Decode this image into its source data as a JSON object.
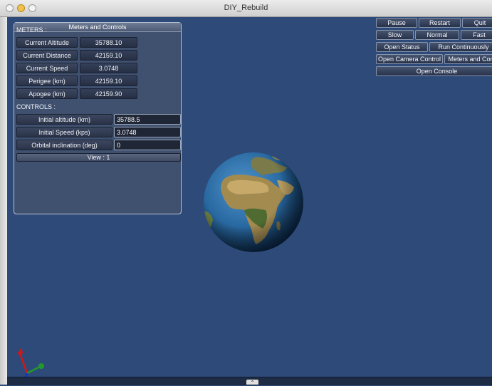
{
  "window": {
    "title": "DIY_Rebuild"
  },
  "panel": {
    "title": "Meters and Controls",
    "meters_label": "METERS :",
    "meters": [
      {
        "label": "Current Altitude",
        "value": "35788.10"
      },
      {
        "label": "Current Distance",
        "value": "42159.10"
      },
      {
        "label": "Current Speed",
        "value": "3.0748"
      },
      {
        "label": "Perigee (km)",
        "value": "42159.10"
      },
      {
        "label": "Apogee (km)",
        "value": "42159.90"
      }
    ],
    "controls_label": "CONTROLS :",
    "controls": [
      {
        "label": "Initial altitude (km)",
        "value": "35788.5"
      },
      {
        "label": "Initial Speed (kps)",
        "value": "3.0748"
      },
      {
        "label": "Orbital inclination (deg)",
        "value": "0"
      }
    ],
    "view_label": "View : 1"
  },
  "toolbar": {
    "pause": "Pause",
    "restart": "Restart",
    "quit": "Quit",
    "slow": "Slow",
    "normal": "Normal",
    "fast": "Fast",
    "open_status": "Open Status",
    "run_continuously": "Run Continuously",
    "open_camera_control": "Open Camera Control",
    "meters_and_controls": "Meters and Con",
    "open_console": "Open Console"
  },
  "bottom": {
    "knob": "⌃"
  },
  "colors": {
    "background": "#2e4a79",
    "panel_border": "#b8c2d4",
    "ocean": "#2f6fa8",
    "land": "#8a7a45",
    "axis_x": "#d01818",
    "axis_y": "#1f9a2a",
    "axis_z": "#1830c8"
  },
  "icons": [
    "close-icon",
    "minimize-icon",
    "zoom-icon",
    "axis-triad-icon",
    "chevron-up-icon"
  ]
}
